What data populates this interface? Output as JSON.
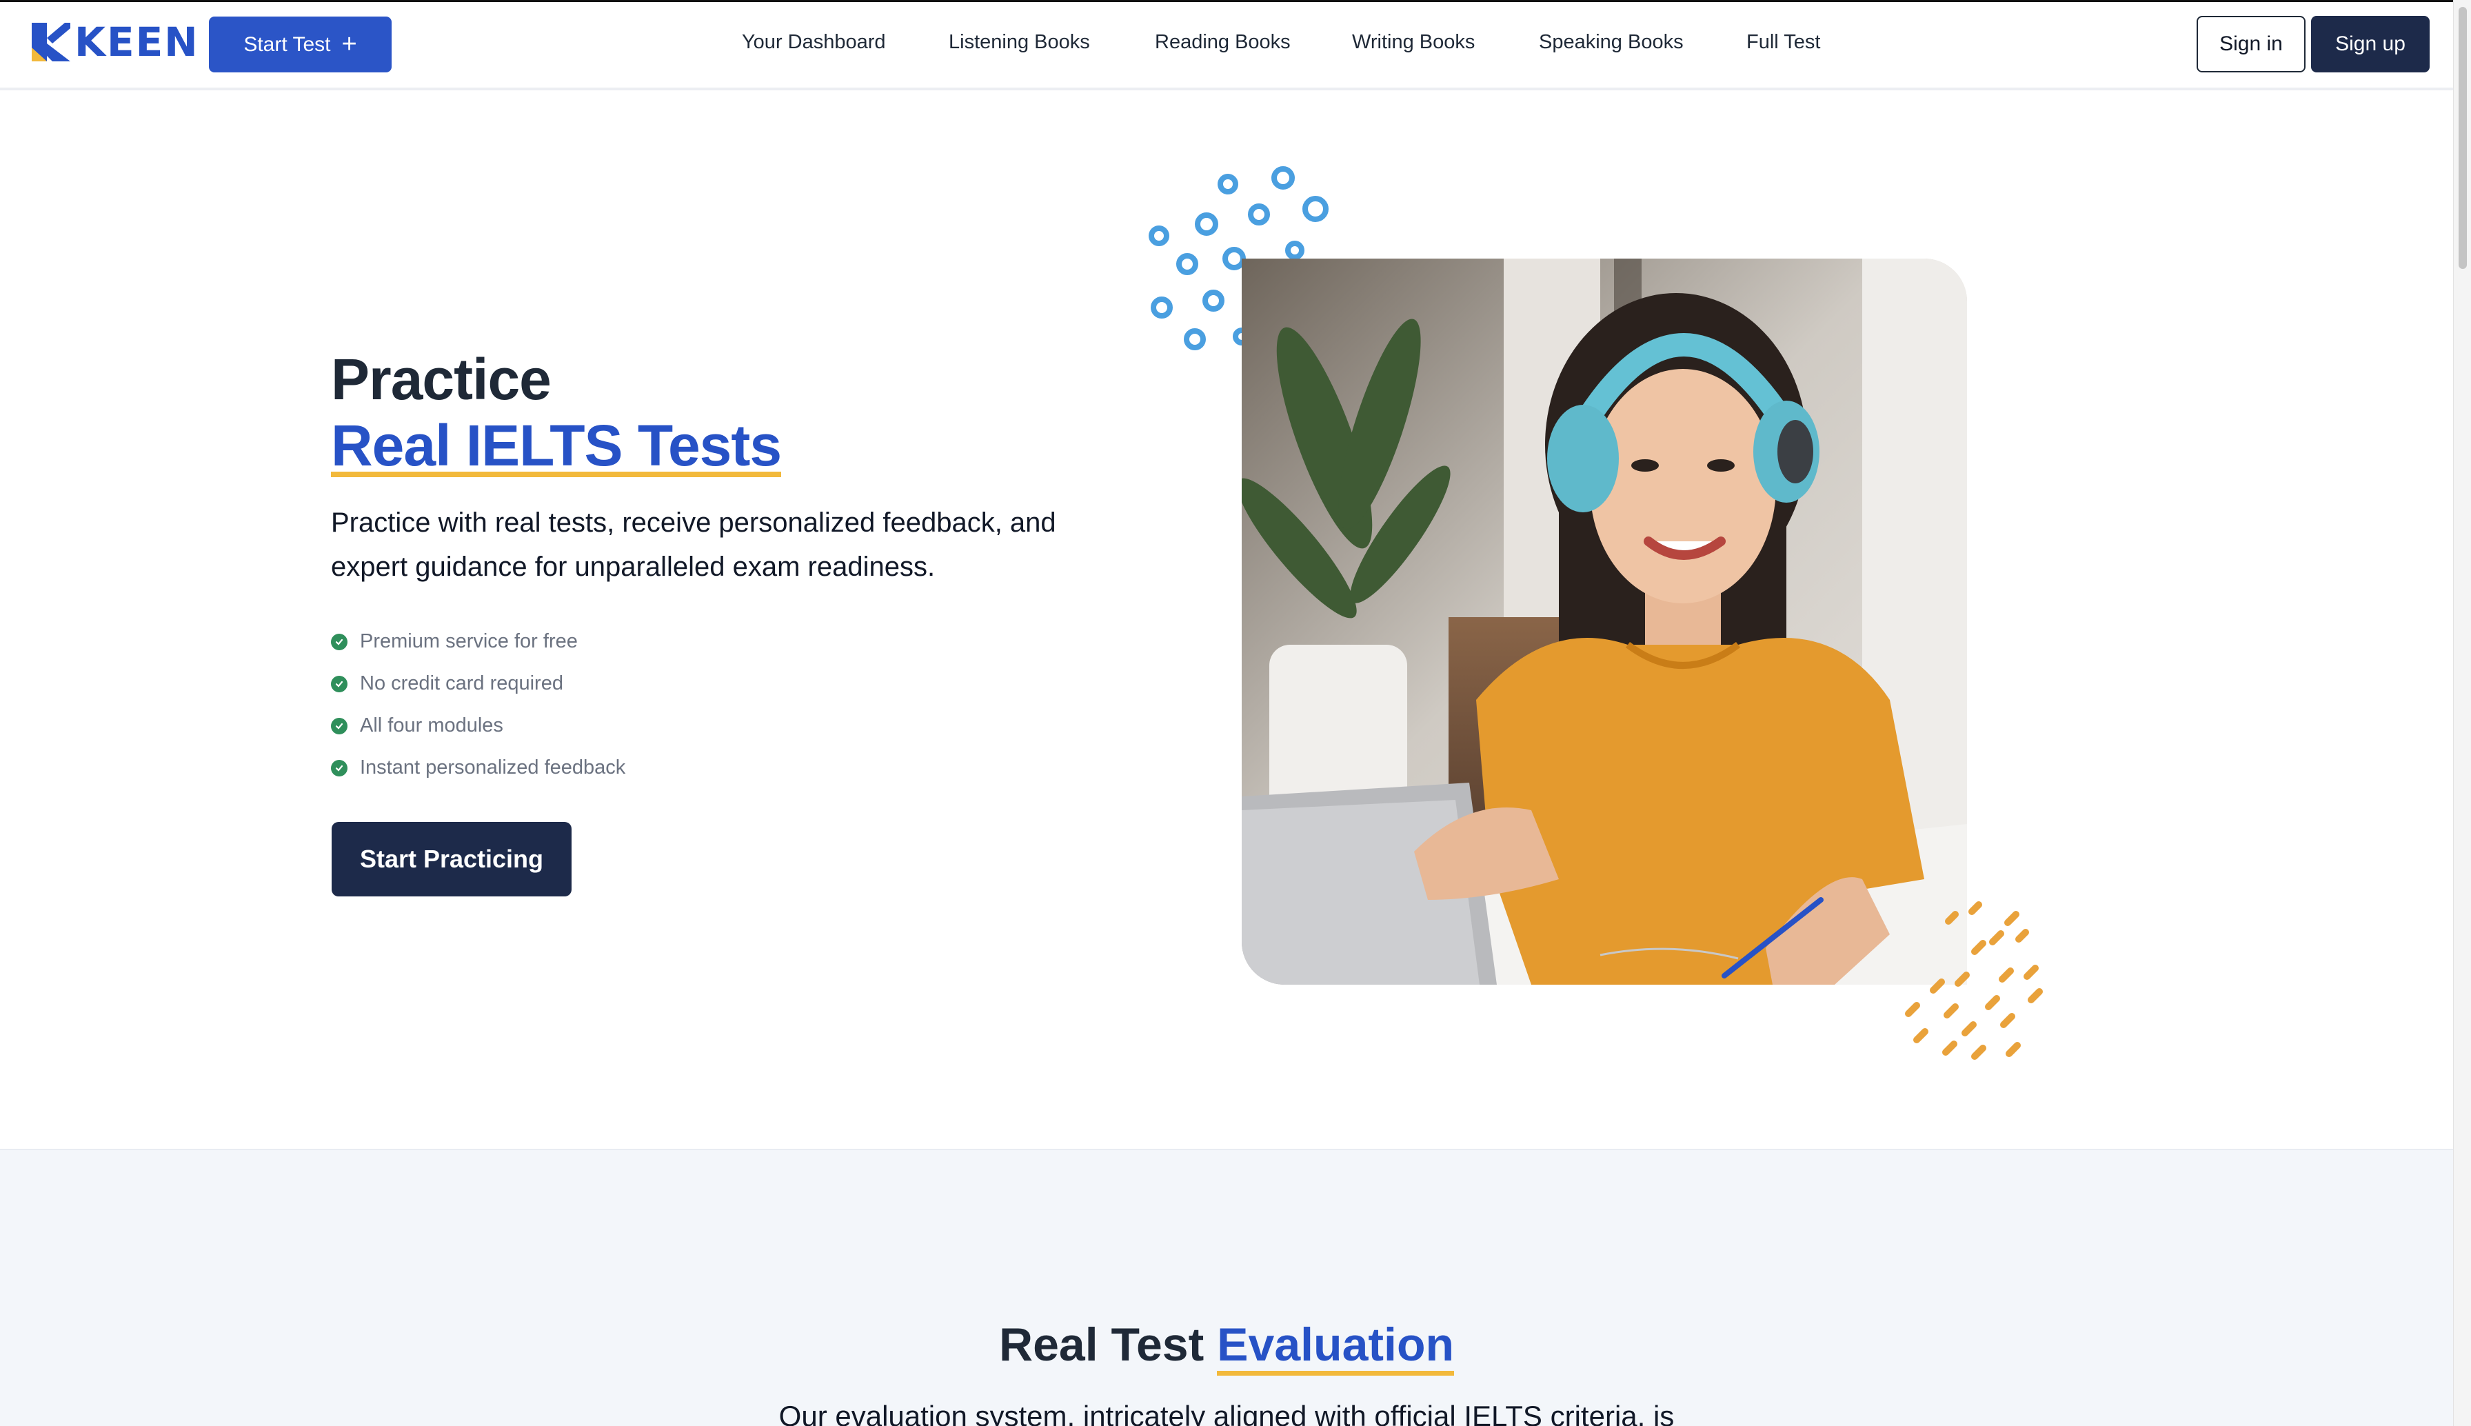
{
  "brand": {
    "name": "KEEN",
    "color": "#2752c6",
    "accent": "#f2b93b"
  },
  "header": {
    "start_test_label": "Start Test",
    "start_test_icon": "plus-icon",
    "links": [
      "Your Dashboard",
      "Listening Books",
      "Reading Books",
      "Writing Books",
      "Speaking Books",
      "Full Test"
    ],
    "sign_in": "Sign in",
    "sign_up": "Sign up"
  },
  "hero": {
    "title_line1": "Practice",
    "title_line2": "Real IELTS Tests",
    "description": "Practice with real tests, receive personalized feedback, and expert guidance for unparalleled exam readiness.",
    "features": [
      "Premium service for free",
      "No credit card required",
      "All four modules",
      "Instant personalized feedback"
    ],
    "feature_icon": "check-circle-icon",
    "cta": "Start Practicing",
    "image": "woman-with-headphones-studying-photo"
  },
  "evaluation": {
    "title_plain": "Real Test ",
    "title_accent": "Evaluation",
    "text": "Our evaluation system, intricately aligned with official IELTS criteria, is"
  }
}
